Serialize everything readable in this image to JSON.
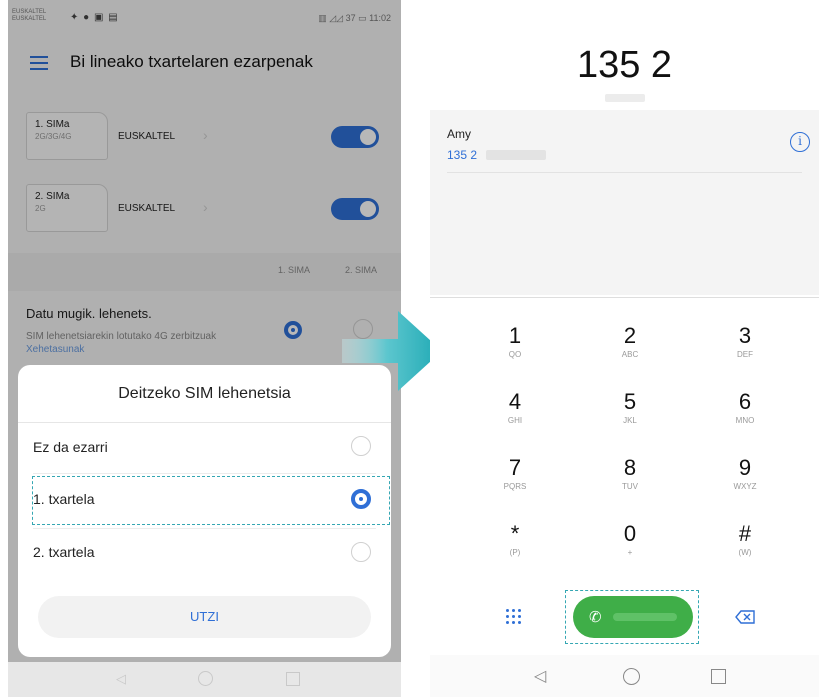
{
  "left_phone": {
    "status": {
      "carrier_line1": "EUSKALTEL",
      "carrier_line2": "EUSKALTEL",
      "battery": "37",
      "time": "11:02"
    },
    "app_title": "Bi lineako txartelaren ezarpenak",
    "sims": [
      {
        "card": "1. SIMa",
        "network": "2G/3G/4G",
        "carrier": "EUSKALTEL",
        "enabled": true
      },
      {
        "card": "2. SIMa",
        "network": "2G",
        "carrier": "EUSKALTEL",
        "enabled": true
      }
    ],
    "columns": [
      "1. SIMA",
      "2. SIMA"
    ],
    "data_pref": {
      "title": "Datu mugik. lehenets.",
      "desc": "SIM lehenetsiarekin lotutako 4G zerbitzuak",
      "link": "Xehetasunak"
    },
    "dialog": {
      "title": "Deitzeko SIM lehenetsia",
      "options": [
        "Ez da ezarri",
        "1. txartela",
        "2. txartela"
      ],
      "selected_index": 1,
      "cancel_label": "UTZI"
    }
  },
  "right_phone": {
    "dialed_number": "135 2",
    "contact": {
      "name": "Amy",
      "number": "135 2"
    },
    "keys": [
      {
        "digit": "1",
        "letters": "QO"
      },
      {
        "digit": "2",
        "letters": "ABC"
      },
      {
        "digit": "3",
        "letters": "DEF"
      },
      {
        "digit": "4",
        "letters": "GHI"
      },
      {
        "digit": "5",
        "letters": "JKL"
      },
      {
        "digit": "6",
        "letters": "MNO"
      },
      {
        "digit": "7",
        "letters": "PQRS"
      },
      {
        "digit": "8",
        "letters": "TUV"
      },
      {
        "digit": "9",
        "letters": "WXYZ"
      },
      {
        "digit": "*",
        "letters": "(P)"
      },
      {
        "digit": "0",
        "letters": "+"
      },
      {
        "digit": "#",
        "letters": "(W)"
      }
    ]
  },
  "colors": {
    "accent_blue": "#2f6fd6",
    "call_green": "#3fae48",
    "highlight_teal": "#35a7b3",
    "arrow_teal": "#34b6bf"
  }
}
